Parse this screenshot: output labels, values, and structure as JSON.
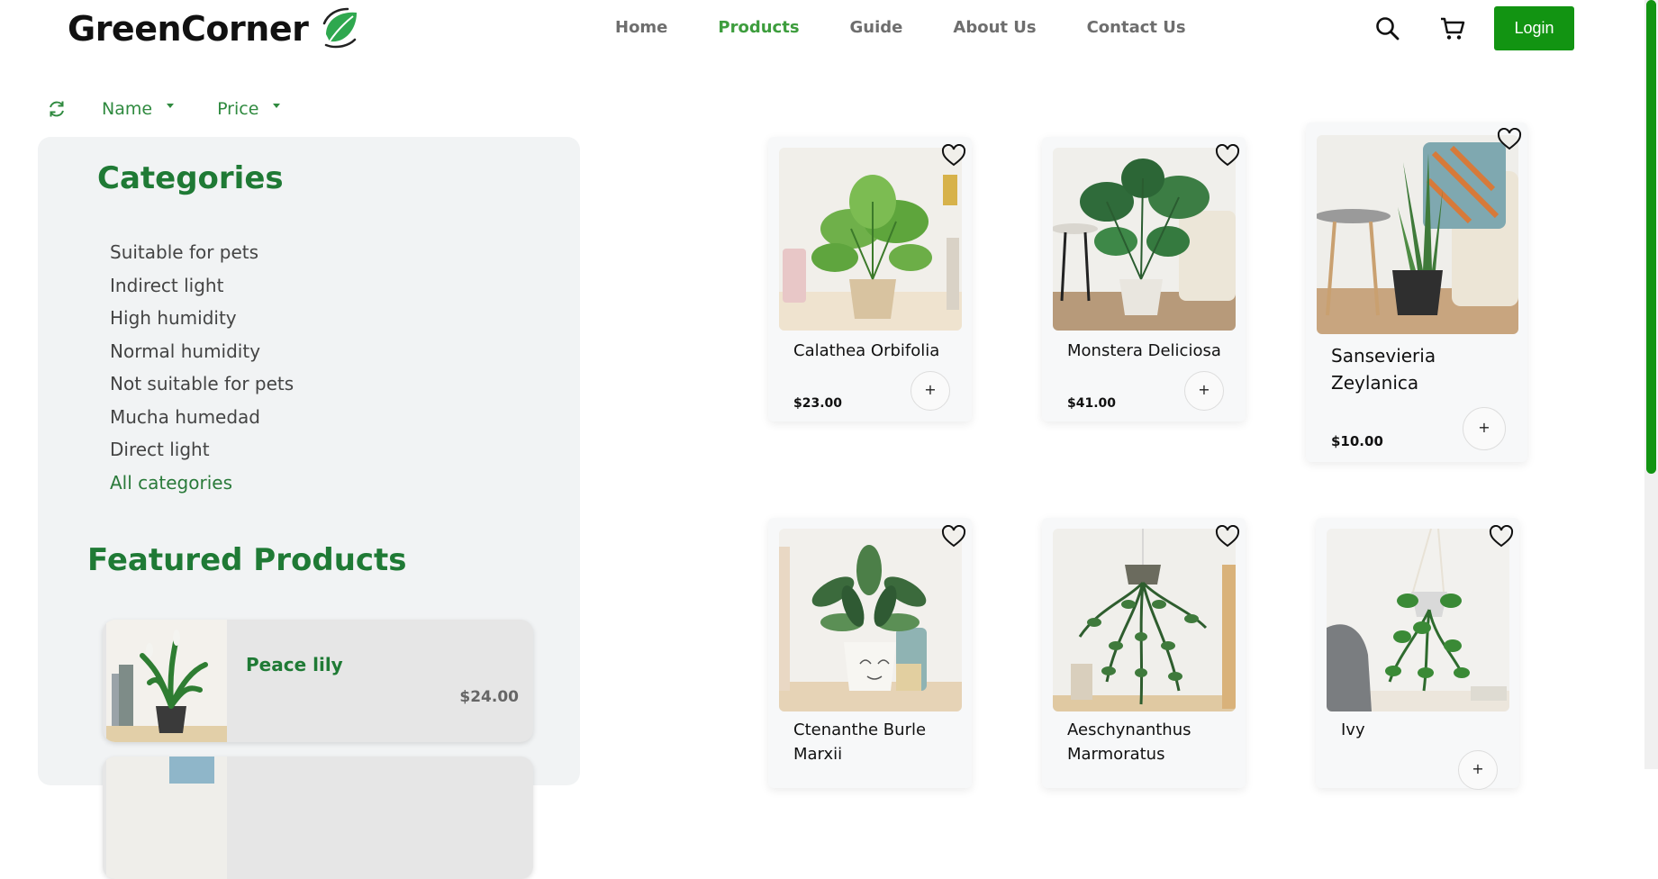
{
  "brand": {
    "name": "GreenCorner",
    "accent": "#129412",
    "nav_active_color": "#3d9d3d",
    "heading_color": "#1f7a35"
  },
  "nav": [
    {
      "label": "Home",
      "active": false
    },
    {
      "label": "Products",
      "active": true
    },
    {
      "label": "Guide",
      "active": false
    },
    {
      "label": "About Us",
      "active": false
    },
    {
      "label": "Contact Us",
      "active": false
    }
  ],
  "header": {
    "login_label": "Login",
    "icons": [
      "search-icon",
      "cart-icon"
    ]
  },
  "filters": {
    "refresh_icon": "refresh-icon",
    "name_label": "Name",
    "price_label": "Price"
  },
  "sidebar": {
    "categories_title": "Categories",
    "categories": [
      "Suitable for pets",
      "Indirect light",
      "High humidity",
      "Normal humidity",
      "Not suitable for pets",
      "Mucha humedad",
      "Direct light",
      "All categories"
    ],
    "featured_title": "Featured Products",
    "featured": [
      {
        "name": "Peace lily",
        "price": "$24.00"
      }
    ]
  },
  "products": [
    {
      "name": "Calathea Orbifolia",
      "price": "$23.00",
      "add_label": "+"
    },
    {
      "name": "Monstera Deliciosa",
      "price": "$41.00",
      "add_label": "+"
    },
    {
      "name": "Sansevieria Zeylanica",
      "price": "$10.00",
      "add_label": "+"
    },
    {
      "name": "Ctenanthe Burle Marxii",
      "price": "",
      "add_label": "+"
    },
    {
      "name": "Aeschynanthus Marmoratus",
      "price": "",
      "add_label": "+"
    },
    {
      "name": "Ivy",
      "price": "",
      "add_label": "+"
    }
  ]
}
